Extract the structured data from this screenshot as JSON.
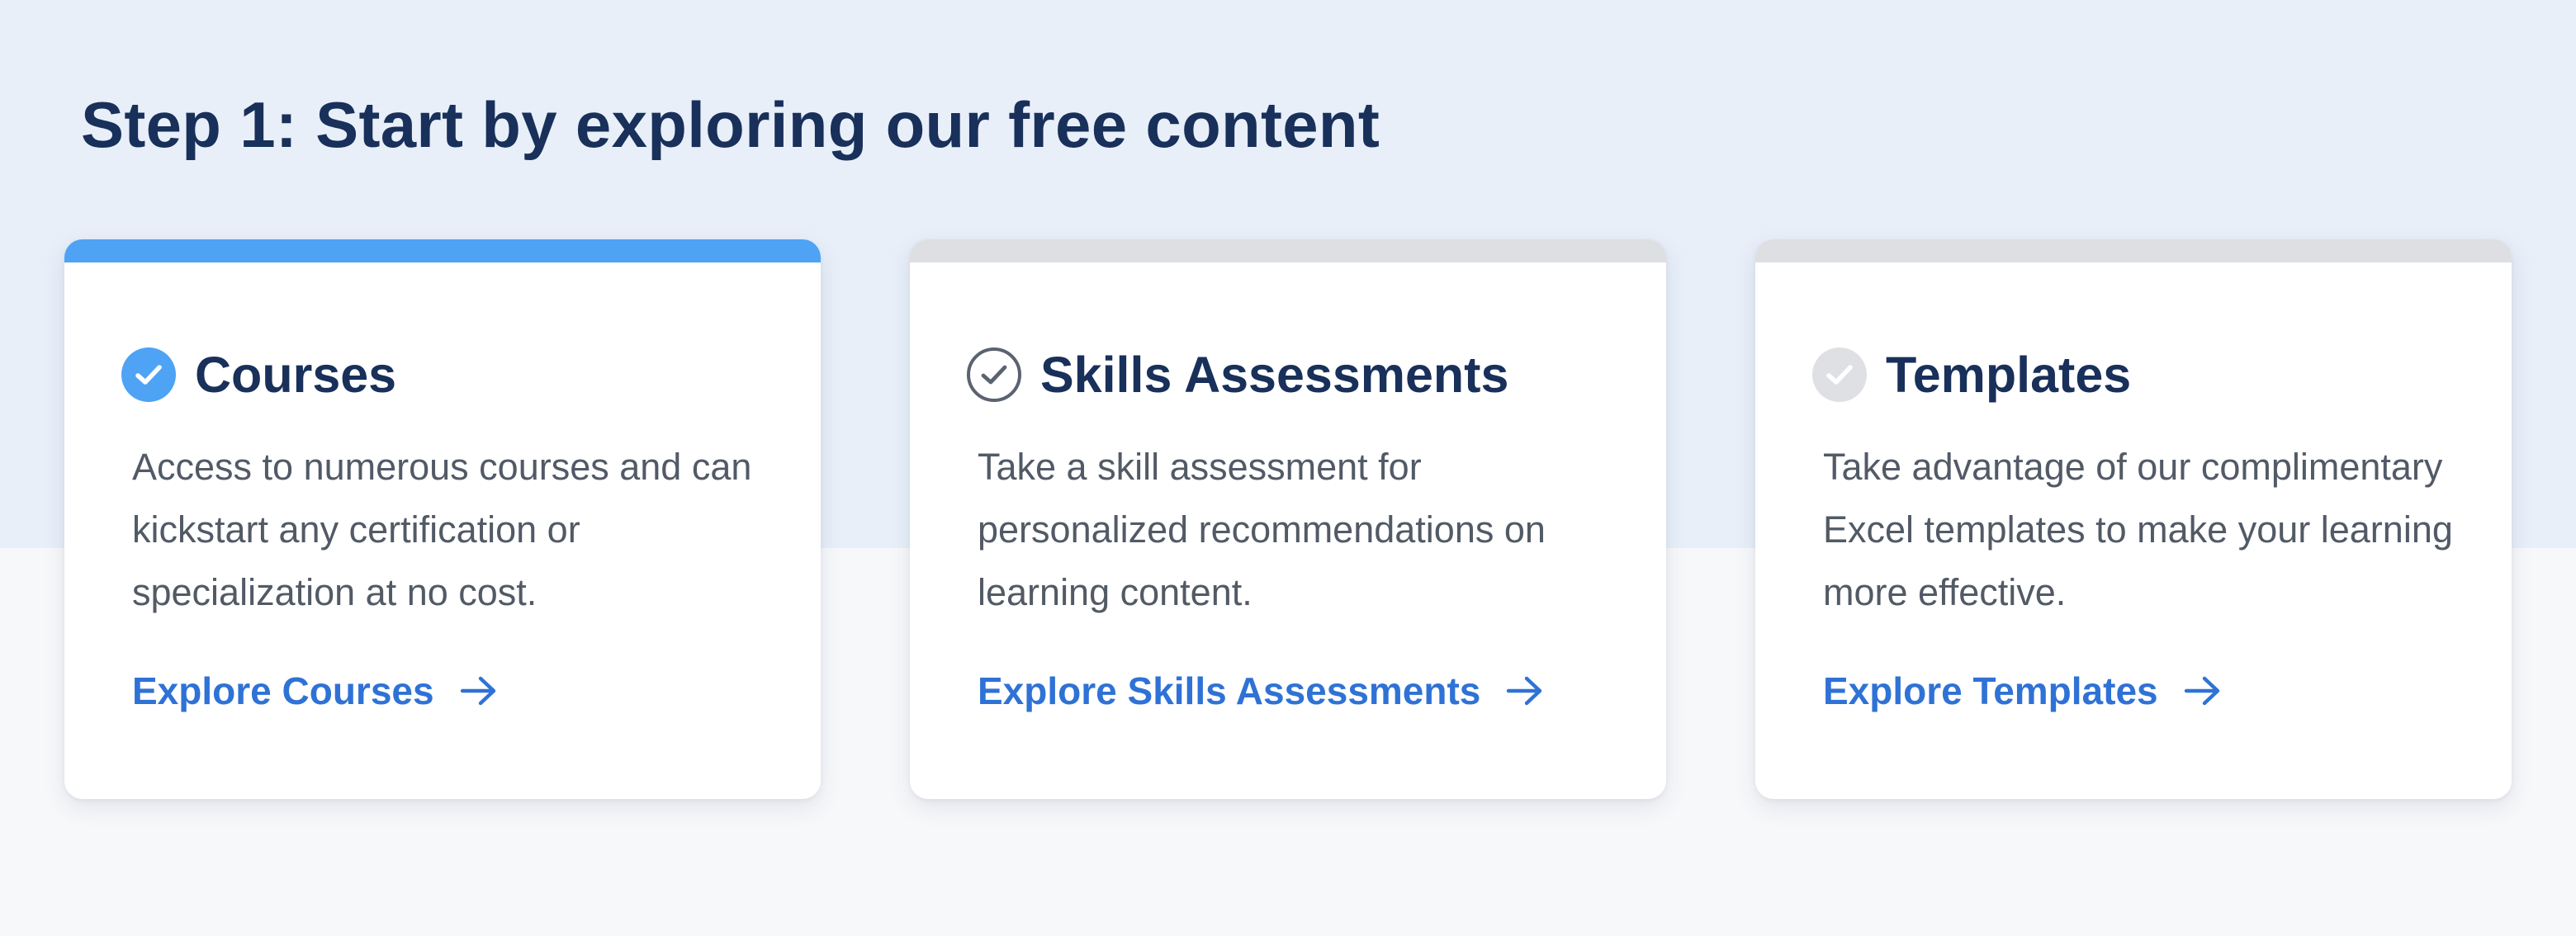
{
  "heading": "Step 1: Start by exploring our free content",
  "colors": {
    "band_background": "#e8eff9",
    "page_background": "#f7f8fa",
    "heading": "#18305a",
    "link": "#2f72d6",
    "active_accent": "#4ea3f5",
    "inactive_bar": "#dedfe2"
  },
  "cards": [
    {
      "title": "Courses",
      "description": "Access to numerous courses and can kickstart any certification or specialization at no cost.",
      "link_label": "Explore Courses",
      "status_icon": "check-circle-filled-blue-icon",
      "active": true
    },
    {
      "title": "Skills Assessments",
      "description": "Take a skill assessment for personalized recommendations on learning content.",
      "link_label": "Explore Skills Assessments",
      "status_icon": "check-circle-outline-icon",
      "active": false
    },
    {
      "title": "Templates",
      "description": "Take advantage of our complimentary Excel templates to make your learning more effective.",
      "link_label": "Explore Templates",
      "status_icon": "check-circle-filled-grey-icon",
      "active": false
    }
  ]
}
